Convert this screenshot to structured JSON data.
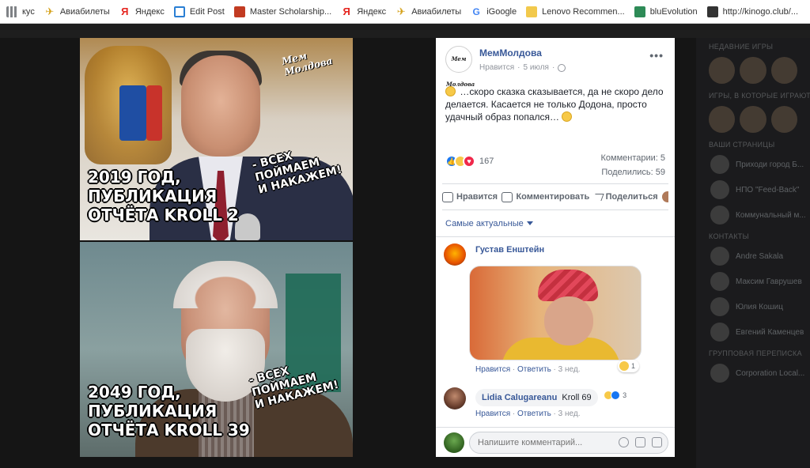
{
  "bookmarks": [
    {
      "label": "кус",
      "icon": "apps-icon"
    },
    {
      "label": "Авиабилеты",
      "icon": "airplane-icon"
    },
    {
      "label": "Яндекс",
      "icon": "yandex-icon"
    },
    {
      "label": "Edit Post",
      "icon": "edit-icon"
    },
    {
      "label": "Master Scholarship...",
      "icon": "master-icon"
    },
    {
      "label": "Яндекс",
      "icon": "yandex-icon"
    },
    {
      "label": "Авиабилеты",
      "icon": "airplane-icon"
    },
    {
      "label": "iGoogle",
      "icon": "google-icon"
    },
    {
      "label": "Lenovo Recommen...",
      "icon": "folder-icon"
    },
    {
      "label": "bluEvolution",
      "icon": "bluevolution-icon"
    },
    {
      "label": "http://kinogo.club/...",
      "icon": "kinogo-icon"
    }
  ],
  "sidebar": {
    "sections": [
      "НЕДАВНИЕ ИГРЫ",
      "ИГРЫ, В КОТОРЫЕ ИГРАЮТ",
      "ВАШИ СТРАНИЦЫ",
      "КОНТАКТЫ",
      "ГРУППОВАЯ ПЕРЕПИСКА"
    ],
    "pages": [
      "Приходи город Б...",
      "НПО \"Feed-Back\"",
      "Коммунальный м..."
    ],
    "contacts": [
      "Andre Sakala",
      "Максим Гаврушев",
      "Юлия Кошиц",
      "Евгений Каменцев"
    ],
    "groups": [
      "Corporation Local..."
    ]
  },
  "meme": {
    "top_caption": "2019 ГОД,\nПУБЛИКАЦИЯ\nОТЧЁТА KROLL 2",
    "top_quote": "- ВСЕХ\nПОЙМАЕМ\nИ НАКАЖЕМ!",
    "bottom_caption": "2049 ГОД,\nПУБЛИКАЦИЯ\nОТЧЁТА KROLL 39",
    "bottom_quote": "- ВСЕХ\nПОЙМАЕМ\nИ НАКАЖЕМ!",
    "watermark": "Мем Молдова"
  },
  "post": {
    "page_name": "МемМолдова",
    "avatar_text": "Мем Молдова",
    "liked_label": "Нравится",
    "date": "5 июля",
    "text": "…скоро сказка сказывается, да не скоро дело делается. Касается не только Додона, просто удачный образ попался…",
    "reactions_count": "167",
    "comments_stat": "Комментарии: 5",
    "shares_stat": "Поделились: 59",
    "more": "•••"
  },
  "actions": {
    "like": "Нравится",
    "comment": "Комментировать",
    "share": "Поделиться"
  },
  "filter_label": "Самые актуальные",
  "comments": [
    {
      "author": "Густав Енштейн",
      "like": "Нравится",
      "reply": "Ответить",
      "time": "3 нед.",
      "reaction_count": "1"
    },
    {
      "author": "Lidia Calugareanu",
      "text": "Kroll 69",
      "like": "Нравится",
      "reply": "Ответить",
      "time": "3 нед.",
      "reaction_count": "3"
    }
  ],
  "composer": {
    "placeholder": "Напишите комментарий..."
  },
  "colors": {
    "link": "#385898",
    "like_blue": "#1877f2",
    "love_red": "#f0284a",
    "haha_yellow": "#f7c948"
  }
}
